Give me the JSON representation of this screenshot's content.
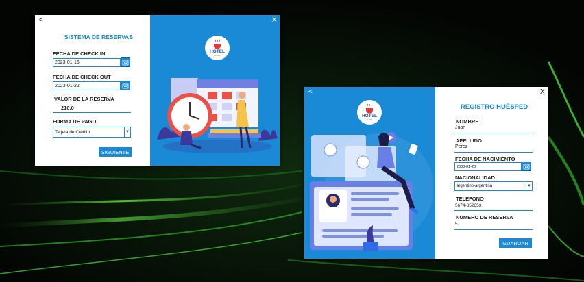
{
  "window_reserva": {
    "back_label": "<",
    "close_label": "X",
    "title": "SISTEMA DE RESERVAS",
    "checkin_label": "FECHA DE CHECK IN",
    "checkin_value": "2023-01-16",
    "checkout_label": "FECHA DE CHECK OUT",
    "checkout_value": "2023-01-22",
    "valor_label": "VALOR DE LA RESERVA",
    "valor_value": "210.0",
    "pago_label": "FORMA DE PAGO",
    "pago_value": "Tarjeta de Crédito",
    "next_button": "SIGUIENTE",
    "logo_text": "HOTEL"
  },
  "window_huesped": {
    "back_label": "<",
    "close_label": "X",
    "title": "REGISTRO HUÉSPED",
    "nombre_label": "NOMBRE",
    "nombre_value": "Juan",
    "apellido_label": "APELLIDO",
    "apellido_value": "Perez",
    "nacimiento_label": "FECHA DE NACIMIENTO",
    "nacimiento_value": "2000-01-20",
    "nacionalidad_label": "NACIONALIDAD",
    "nacionalidad_value": "argentino-argentina",
    "telefono_label": "TELEFONO",
    "telefono_value": "5674-852653",
    "reserva_label": "NUMERO DE RESERVA",
    "reserva_value": "5",
    "save_button": "GUARDAR",
    "logo_text": "HOTEL"
  },
  "colors": {
    "accent": "#1a8ad6",
    "background": "#050805",
    "glow": "#39e63a"
  },
  "icons": [
    "calendar-icon",
    "dropdown-arrow-icon",
    "hotel-logo-icon"
  ]
}
